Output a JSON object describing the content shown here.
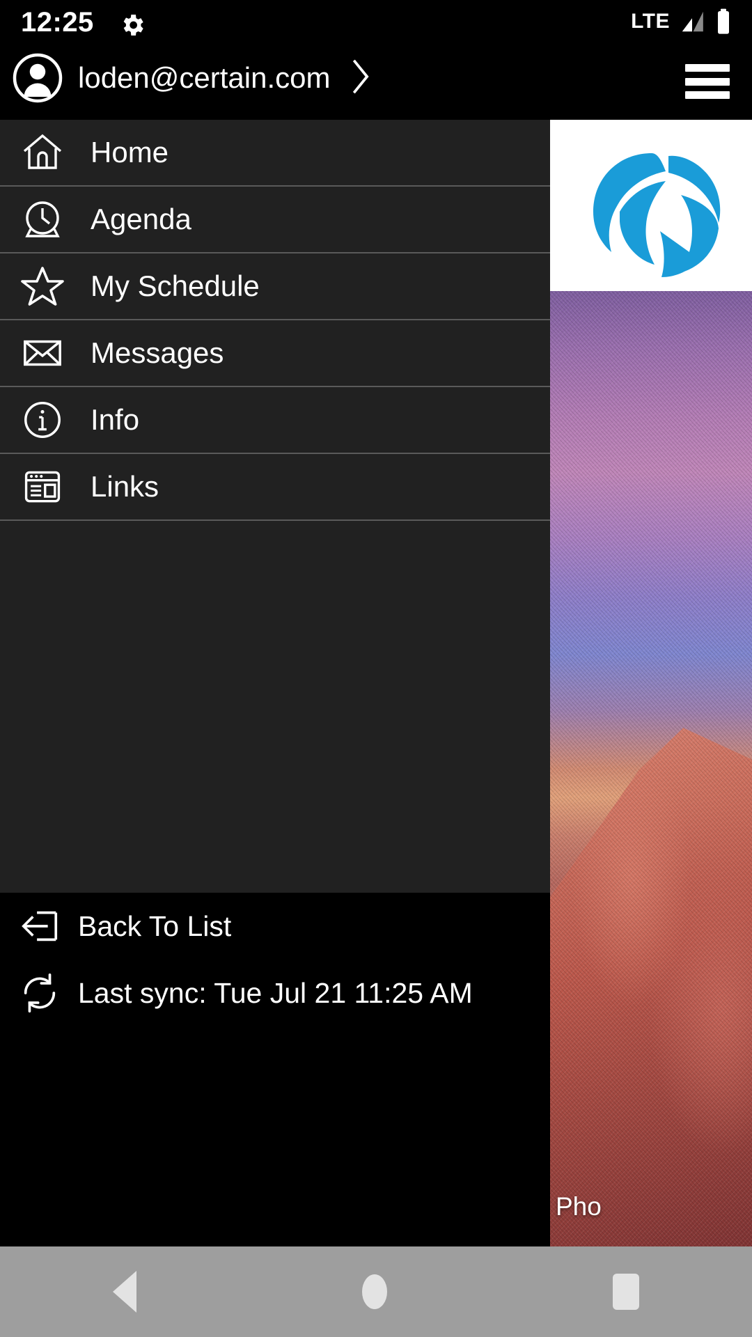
{
  "status_bar": {
    "time": "12:25",
    "gear_icon": "gear-icon",
    "network": "LTE",
    "signal_icon": "signal-bars-icon",
    "battery_icon": "battery-full-icon"
  },
  "drawer_header": {
    "avatar_icon": "user-avatar-icon",
    "account_email": "loden@certain.com",
    "chevron_icon": "chevron-right-icon",
    "menu_icon": "hamburger-menu-icon"
  },
  "nav_items": [
    {
      "label": "Home",
      "icon": "home-icon"
    },
    {
      "label": "Agenda",
      "icon": "clock-icon"
    },
    {
      "label": "My Schedule",
      "icon": "star-icon"
    },
    {
      "label": "Messages",
      "icon": "envelope-icon"
    },
    {
      "label": "Info",
      "icon": "info-circle-icon"
    },
    {
      "label": "Links",
      "icon": "browser-window-icon"
    }
  ],
  "drawer_footer": {
    "back_to_list_label": "Back To List",
    "back_to_list_icon": "arrow-into-bracket-icon",
    "last_sync_label": "Last sync: Tue Jul 21 11:25 AM",
    "sync_icon": "refresh-sync-icon"
  },
  "app_behind": {
    "logo_icon": "certain-globe-logo",
    "logo_color": "#1a9cd8",
    "photo_caption": "Pho"
  },
  "android_nav": {
    "back_icon": "nav-back-icon",
    "home_icon": "nav-home-icon",
    "recents_icon": "nav-recents-icon"
  },
  "colors": {
    "drawer_bg": "#212121",
    "drawer_divider": "#5a5a5a",
    "header_bg": "#000000",
    "text": "#ffffff",
    "navbar_bg": "#9e9e9e",
    "navbar_glyph": "#e3e3e3"
  }
}
